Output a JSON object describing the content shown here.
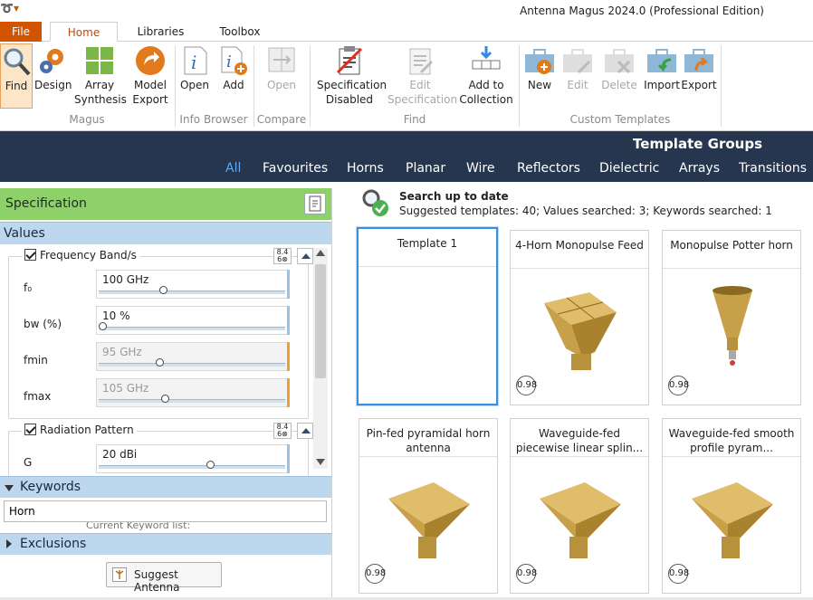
{
  "window": {
    "title": "Antenna Magus 2024.0 (Professional Edition)"
  },
  "tabs": [
    "File",
    "Home",
    "Libraries",
    "Toolbox"
  ],
  "ribbon": {
    "buttons": {
      "find": "Find",
      "design": "Design",
      "array_synthesis": "Array\nSynthesis",
      "model_export": "Model\nExport",
      "open_info": "Open",
      "add_info": "Add",
      "open_compare": "Open",
      "spec_disabled": "Specification\nDisabled",
      "edit_spec": "Edit\nSpecification",
      "add_collection": "Add to\nCollection",
      "new": "New",
      "edit": "Edit",
      "delete": "Delete",
      "import": "Import",
      "export": "Export"
    },
    "groups": {
      "magus": "Magus",
      "info_browser": "Info Browser",
      "compare": "Compare",
      "find": "Find",
      "custom_templates": "Custom Templates"
    }
  },
  "template_groups": {
    "title": "Template Groups",
    "tabs": [
      "All",
      "Favourites",
      "Horns",
      "Planar",
      "Wire",
      "Reflectors",
      "Dielectric",
      "Arrays",
      "Transitions"
    ],
    "selected": "All"
  },
  "specification": {
    "title": "Specification",
    "values_title": "Values",
    "groups": [
      {
        "label": "Frequency Band/s",
        "checked": true,
        "rows": [
          {
            "label": "f₀",
            "value": "100 GHz",
            "level": 0.34,
            "enabled": true,
            "bar": "#9fc1e0"
          },
          {
            "label": "bw (%)",
            "value": "10 %",
            "level": 0.0,
            "enabled": true,
            "bar": "#9fc1e0"
          },
          {
            "label": "fmin",
            "value": "95 GHz",
            "level": 0.32,
            "enabled": false,
            "bar": "#f0a030"
          },
          {
            "label": "fmax",
            "value": "105 GHz",
            "level": 0.35,
            "enabled": false,
            "bar": "#f0a030"
          }
        ]
      },
      {
        "label": "Radiation Pattern",
        "checked": true,
        "rows": [
          {
            "label": "G",
            "value": "20 dBi",
            "level": 0.6,
            "enabled": true,
            "bar": "#9fc1e0"
          }
        ]
      }
    ],
    "dots": "•••••",
    "keywords_title": "Keywords",
    "keyword_value": "Horn",
    "keyword_list_label": "Current Keyword list:",
    "exclusions_title": "Exclusions",
    "suggest_label": "Suggest Antenna"
  },
  "search": {
    "title": "Search up to date",
    "detail": "Suggested templates: 40; Values searched: 3; Keywords searched: 1"
  },
  "templates": [
    {
      "title": "Template 1",
      "score": "",
      "selected": true,
      "shape": "none"
    },
    {
      "title": "4-Horn Monopulse Feed",
      "score": "0.98",
      "selected": false,
      "shape": "quad"
    },
    {
      "title": "Monopulse Potter horn",
      "score": "0.98",
      "selected": false,
      "shape": "potter"
    },
    {
      "title": "Pin-fed pyramidal horn antenna",
      "score": "0.98",
      "selected": false,
      "shape": "pyramid"
    },
    {
      "title": "Waveguide-fed piecewise linear splin...",
      "score": "0.98",
      "selected": false,
      "shape": "pyramid"
    },
    {
      "title": "Waveguide-fed smooth profile pyram...",
      "score": "0.98",
      "selected": false,
      "shape": "pyramid"
    }
  ],
  "colors": {
    "accent": "#d35400",
    "nav_bg": "#26364f",
    "spec_green": "#8ed16b",
    "section_blue": "#bcd7ee",
    "horn_gold": "#c8a04a",
    "selection": "#3a8fe0"
  }
}
